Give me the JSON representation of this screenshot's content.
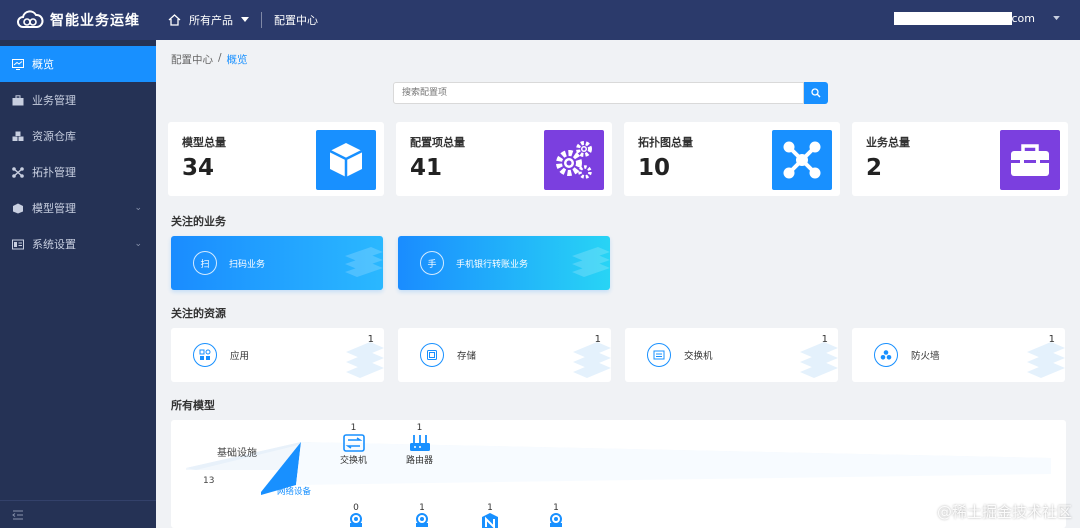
{
  "app": {
    "title": "智能业务运维"
  },
  "topnav": {
    "products": "所有产品",
    "config_center": "配置中心",
    "user_suffix": "com"
  },
  "sidebar": {
    "items": [
      {
        "label": "概览",
        "icon": "dashboard-icon",
        "active": true
      },
      {
        "label": "业务管理",
        "icon": "briefcase-icon"
      },
      {
        "label": "资源仓库",
        "icon": "cubes-icon"
      },
      {
        "label": "拓扑管理",
        "icon": "topology-icon"
      },
      {
        "label": "模型管理",
        "icon": "cube-icon",
        "expandable": true
      },
      {
        "label": "系统设置",
        "icon": "settings-icon",
        "expandable": true
      }
    ]
  },
  "breadcrumb": {
    "root": "配置中心",
    "separator": "/",
    "current": "概览"
  },
  "search": {
    "placeholder": "搜索配置项"
  },
  "stats": [
    {
      "label": "模型总量",
      "value": "34",
      "icon": "cube-icon",
      "color": "#1890ff"
    },
    {
      "label": "配置项总量",
      "value": "41",
      "icon": "gears-icon",
      "color": "#7b3fdf"
    },
    {
      "label": "拓扑图总量",
      "value": "10",
      "icon": "topology-icon",
      "color": "#1890ff"
    },
    {
      "label": "业务总量",
      "value": "2",
      "icon": "toolbox-icon",
      "color": "#7b3fdf"
    }
  ],
  "sections": {
    "business": "关注的业务",
    "resources": "关注的资源",
    "models": "所有模型"
  },
  "business": [
    {
      "char": "扫",
      "label": "扫码业务"
    },
    {
      "char": "手",
      "label": "手机银行转账业务"
    }
  ],
  "resources": [
    {
      "label": "应用",
      "count": "1",
      "icon": "app-icon"
    },
    {
      "label": "存储",
      "count": "1",
      "icon": "storage-icon"
    },
    {
      "label": "交换机",
      "count": "1",
      "icon": "switch-icon"
    },
    {
      "label": "防火墙",
      "count": "1",
      "icon": "firewall-icon"
    }
  ],
  "models": {
    "group": {
      "title": "基础设施",
      "count": "13",
      "sublabel": "网络设备"
    },
    "nodes_row1": [
      {
        "count": "1",
        "label": "交换机",
        "icon": "switch-icon"
      },
      {
        "count": "1",
        "label": "路由器",
        "icon": "router-icon"
      }
    ],
    "nodes_row2": [
      {
        "count": "0",
        "icon": "device-icon"
      },
      {
        "count": "1",
        "icon": "device-icon"
      },
      {
        "count": "1",
        "icon": "n-icon"
      },
      {
        "count": "1",
        "icon": "device-icon"
      }
    ]
  },
  "watermark": "@稀土掘金技术社区",
  "colors": {
    "topbar": "#2b3a6b",
    "sidebar": "#253255",
    "accent": "#1890ff",
    "purple": "#7b3fdf"
  }
}
